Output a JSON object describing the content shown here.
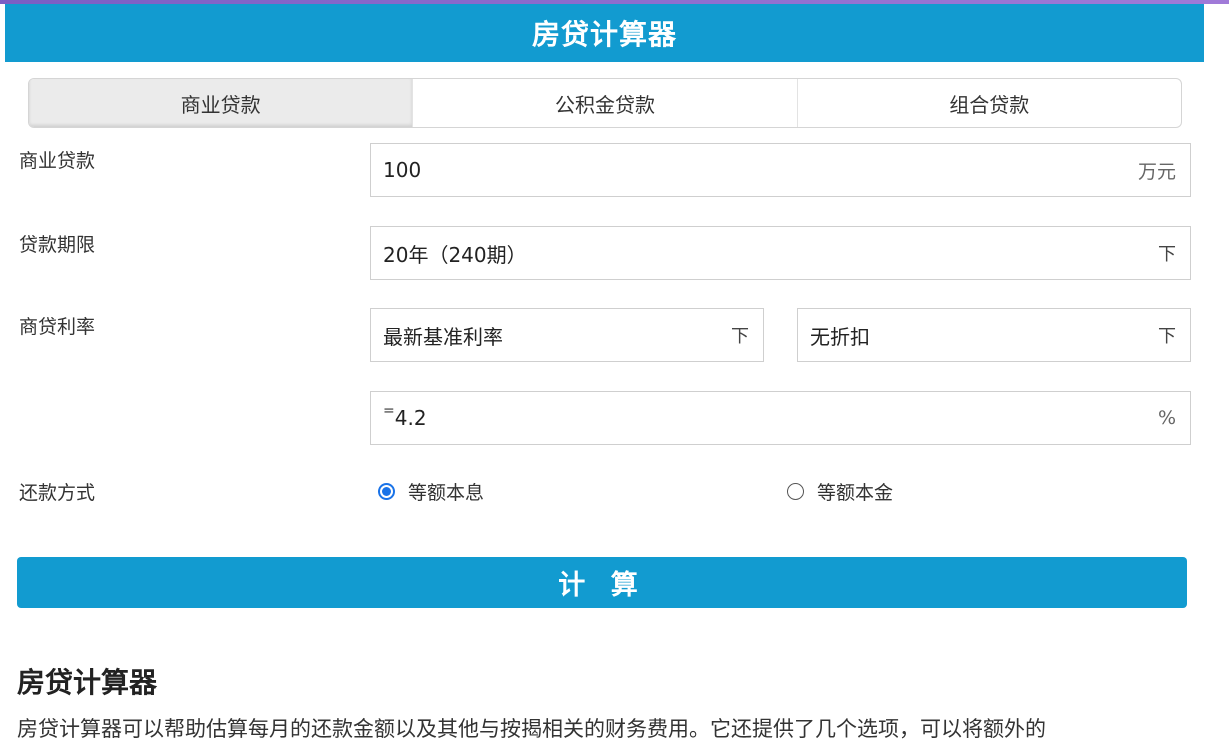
{
  "header": {
    "title": "房贷计算器"
  },
  "tabs": [
    {
      "label": "商业贷款",
      "active": true
    },
    {
      "label": "公积金贷款",
      "active": false
    },
    {
      "label": "组合贷款",
      "active": false
    }
  ],
  "form": {
    "loan_amount": {
      "label": "商业贷款",
      "value": "100",
      "suffix": "万元"
    },
    "loan_term": {
      "label": "贷款期限",
      "value": "20年（240期）",
      "arrow": "下"
    },
    "rate": {
      "label": "商贷利率",
      "base_select": {
        "value": "最新基准利率",
        "arrow": "下"
      },
      "discount_select": {
        "value": "无折扣",
        "arrow": "下"
      },
      "result": {
        "prefix": "=",
        "value": "4.2",
        "suffix": "%"
      }
    },
    "repayment": {
      "label": "还款方式",
      "options": [
        {
          "label": "等额本息",
          "checked": true
        },
        {
          "label": "等额本金",
          "checked": false
        }
      ]
    }
  },
  "calculate_button": {
    "label": "计 算"
  },
  "info": {
    "title": "房贷计算器",
    "description": "房贷计算器可以帮助估算每月的还款金额以及其他与按揭相关的财务费用。它还提供了几个选项，可以将额外的"
  },
  "colors": {
    "accent": "#129bd0",
    "radio_checked": "#1a73e8"
  }
}
